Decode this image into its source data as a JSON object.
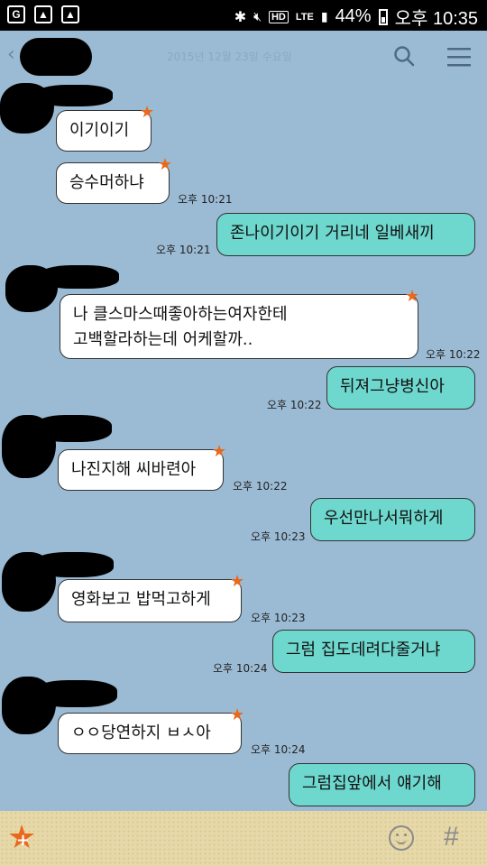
{
  "status_bar": {
    "battery": "44%",
    "lte": "LTE",
    "hd": "HD",
    "time": "오후 10:35"
  },
  "header": {
    "back_icon": "chevron-left-icon",
    "date": "2015년 12월 23일 수요일",
    "search_icon": "search-icon",
    "menu_icon": "hamburger-menu-icon"
  },
  "messages": [
    {
      "side": "in",
      "text": "이기이기"
    },
    {
      "side": "in",
      "text": "승수머하냐",
      "time": "오후 10:21"
    },
    {
      "side": "out",
      "text": "존나이기이기 거리네 일베새끼",
      "time": "오후 10:21"
    },
    {
      "side": "in",
      "text": "나 클스마스때좋아하는여자한테\n고백할라하는데 어케할까..",
      "time": "오후 10:22"
    },
    {
      "side": "out",
      "text": "뒤져그냥병신아",
      "time": "오후 10:22"
    },
    {
      "side": "in",
      "text": "나진지해 씨바련아",
      "time": "오후 10:22"
    },
    {
      "side": "out",
      "text": "우선만나서뭐하게",
      "time": "오후 10:23"
    },
    {
      "side": "in",
      "text": "영화보고 밥먹고하게",
      "time": "오후 10:23"
    },
    {
      "side": "out",
      "text": "그럼 집도데려다줄거냐",
      "time": "오후 10:24"
    },
    {
      "side": "in",
      "text": "ㅇㅇ당연하지 ㅂㅅ아",
      "time": "오후 10:24"
    },
    {
      "side": "out",
      "text": "그럼집앞에서 얘기해"
    }
  ],
  "input_bar": {
    "add_icon": "star-add-icon",
    "emoji_icon": "smile-icon",
    "hash_symbol": "#"
  },
  "colors": {
    "background": "#9bbbd4",
    "outgoing_bubble": "#6ed7ce",
    "incoming_bubble": "#ffffff",
    "accent_star": "#e8681c"
  }
}
